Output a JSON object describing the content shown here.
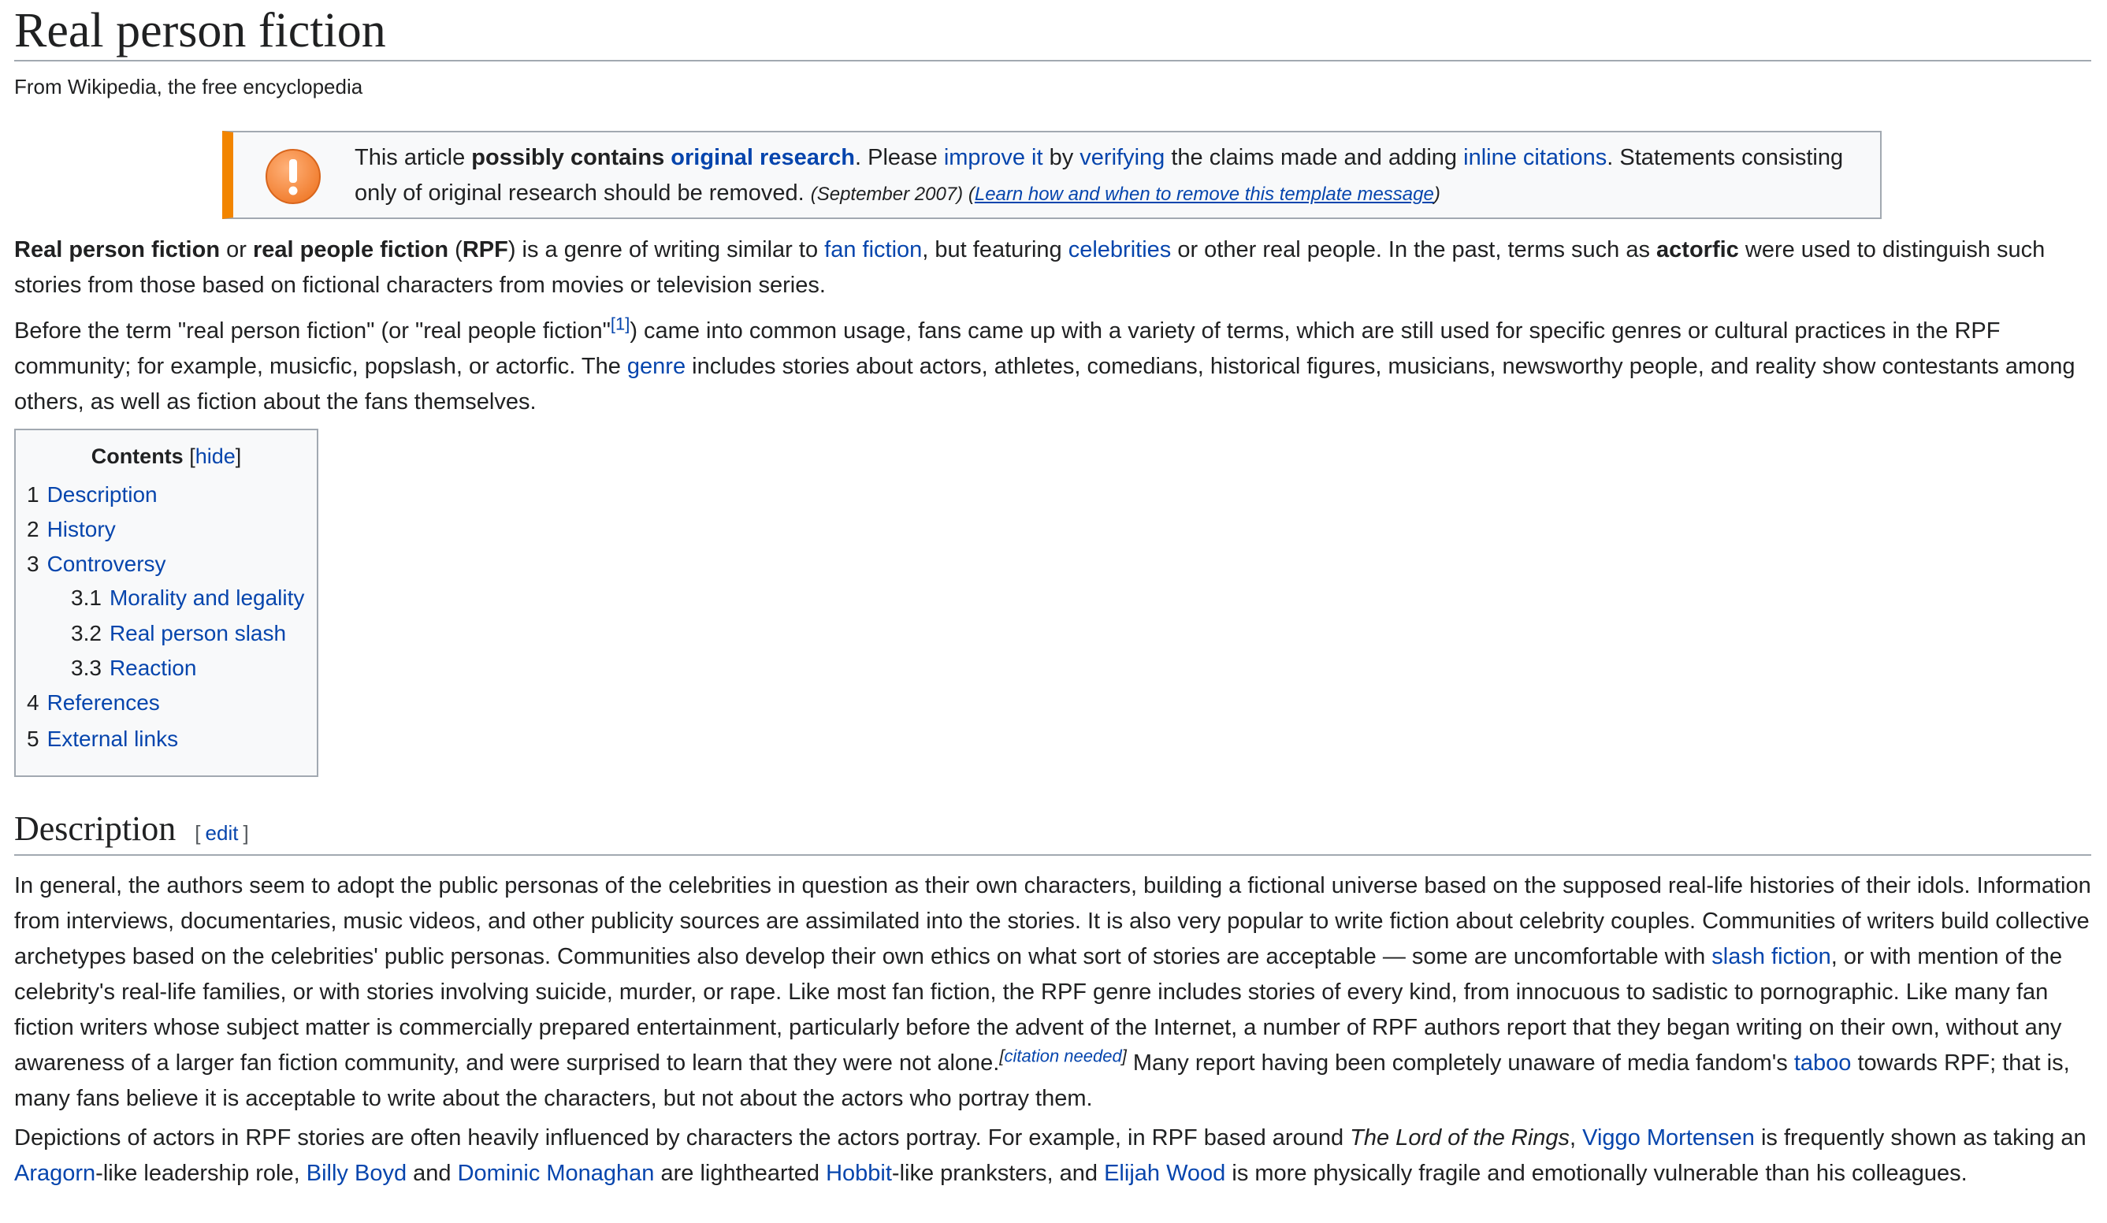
{
  "article": {
    "title": "Real person fiction",
    "tagline": "From Wikipedia, the free encyclopedia"
  },
  "ambox": {
    "icon": "exclamation-icon",
    "accent_color": "#f28500",
    "t1": "This article ",
    "bold1": "possibly contains ",
    "link_or": "original research",
    "t2": ". Please ",
    "link_improve": "improve it",
    "t3": " by ",
    "link_verifying": "verifying",
    "t4": " the claims made and adding ",
    "link_inline": "inline citations",
    "t5": ". Statements consisting only of original research should be removed. ",
    "date": "(September 2007)",
    "paren_open": " (",
    "link_learn": "Learn how and when to remove this template message",
    "paren_close": ")"
  },
  "intro": {
    "p1": {
      "b1": "Real person fiction",
      "t1": " or ",
      "b2": "real people fiction",
      "t2": " (",
      "b3": "RPF",
      "t3": ") is a genre of writing similar to ",
      "link_fanfic": "fan fiction",
      "t4": ", but featuring ",
      "link_celebs": "celebrities",
      "t5": " or other real people. In the past, terms such as ",
      "b4": "actorfic",
      "t6": " were used to distinguish such stories from those based on fictional characters from movies or television series."
    },
    "p2": {
      "t1": "Before the term \"real person fiction\" (or \"real people fiction\"",
      "ref1": "[1]",
      "t2": ") came into common usage, fans came up with a variety of terms, which are still used for specific genres or cultural practices in the RPF community; for example, musicfic, popslash, or actorfic. The ",
      "link_genre": "genre",
      "t3": " includes stories about actors, athletes, comedians, historical figures, musicians, newsworthy people, and reality show contestants among others, as well as fiction about the fans themselves."
    }
  },
  "toc": {
    "title": "Contents",
    "hide_open": " [",
    "hide": "hide",
    "hide_close": "]",
    "items": [
      {
        "num": "1",
        "label": "Description"
      },
      {
        "num": "2",
        "label": "History"
      },
      {
        "num": "3",
        "label": "Controversy"
      },
      {
        "num": "3.1",
        "label": "Morality and legality"
      },
      {
        "num": "3.2",
        "label": "Real person slash"
      },
      {
        "num": "3.3",
        "label": "Reaction"
      },
      {
        "num": "4",
        "label": "References"
      },
      {
        "num": "5",
        "label": "External links"
      }
    ]
  },
  "description": {
    "heading": "Description",
    "edit_open": "[",
    "edit": "edit",
    "edit_close": "]",
    "p1": {
      "t1": "In general, the authors seem to adopt the public personas of the celebrities in question as their own characters, building a fictional universe based on the supposed real-life histories of their idols. Information from interviews, documentaries, music videos, and other publicity sources are assimilated into the stories. It is also very popular to write fiction about celebrity couples. Communities of writers build collective archetypes based on the celebrities' public personas. Communities also develop their own ethics on what sort of stories are acceptable — some are uncomfortable with ",
      "link_slash": "slash fiction",
      "t2": ", or with mention of the celebrity's real-life families, or with stories involving suicide, murder, or rape. Like most fan fiction, the RPF genre includes stories of every kind, from innocuous to sadistic to pornographic. Like many fan fiction writers whose subject matter is commercially prepared entertainment, particularly before the advent of the Internet, a number of RPF authors report that they began writing on their own, without any awareness of a larger fan fiction community, and were surprised to learn that they were not alone.",
      "cn_open": "[",
      "cn": "citation needed",
      "cn_close": "]",
      "t3": " Many report having been completely unaware of media fandom's ",
      "link_taboo": "taboo",
      "t4": " towards RPF; that is, many fans believe it is acceptable to write about the characters, but not about the actors who portray them."
    },
    "p2": {
      "t1": "Depictions of actors in RPF stories are often heavily influenced by characters the actors portray. For example, in RPF based around ",
      "i1": "The Lord of the Rings",
      "t2": ", ",
      "link_viggo": "Viggo Mortensen",
      "t3": " is frequently shown as taking an ",
      "link_aragorn": "Aragorn",
      "t4": "-like leadership role, ",
      "link_billy": "Billy Boyd",
      "t5": " and ",
      "link_dominic": "Dominic Monaghan",
      "t6": " are lighthearted ",
      "link_hobbit": "Hobbit",
      "t7": "-like pranksters, and ",
      "link_elijah": "Elijah Wood",
      "t8": " is more physically fragile and emotionally vulnerable than his colleagues."
    }
  }
}
